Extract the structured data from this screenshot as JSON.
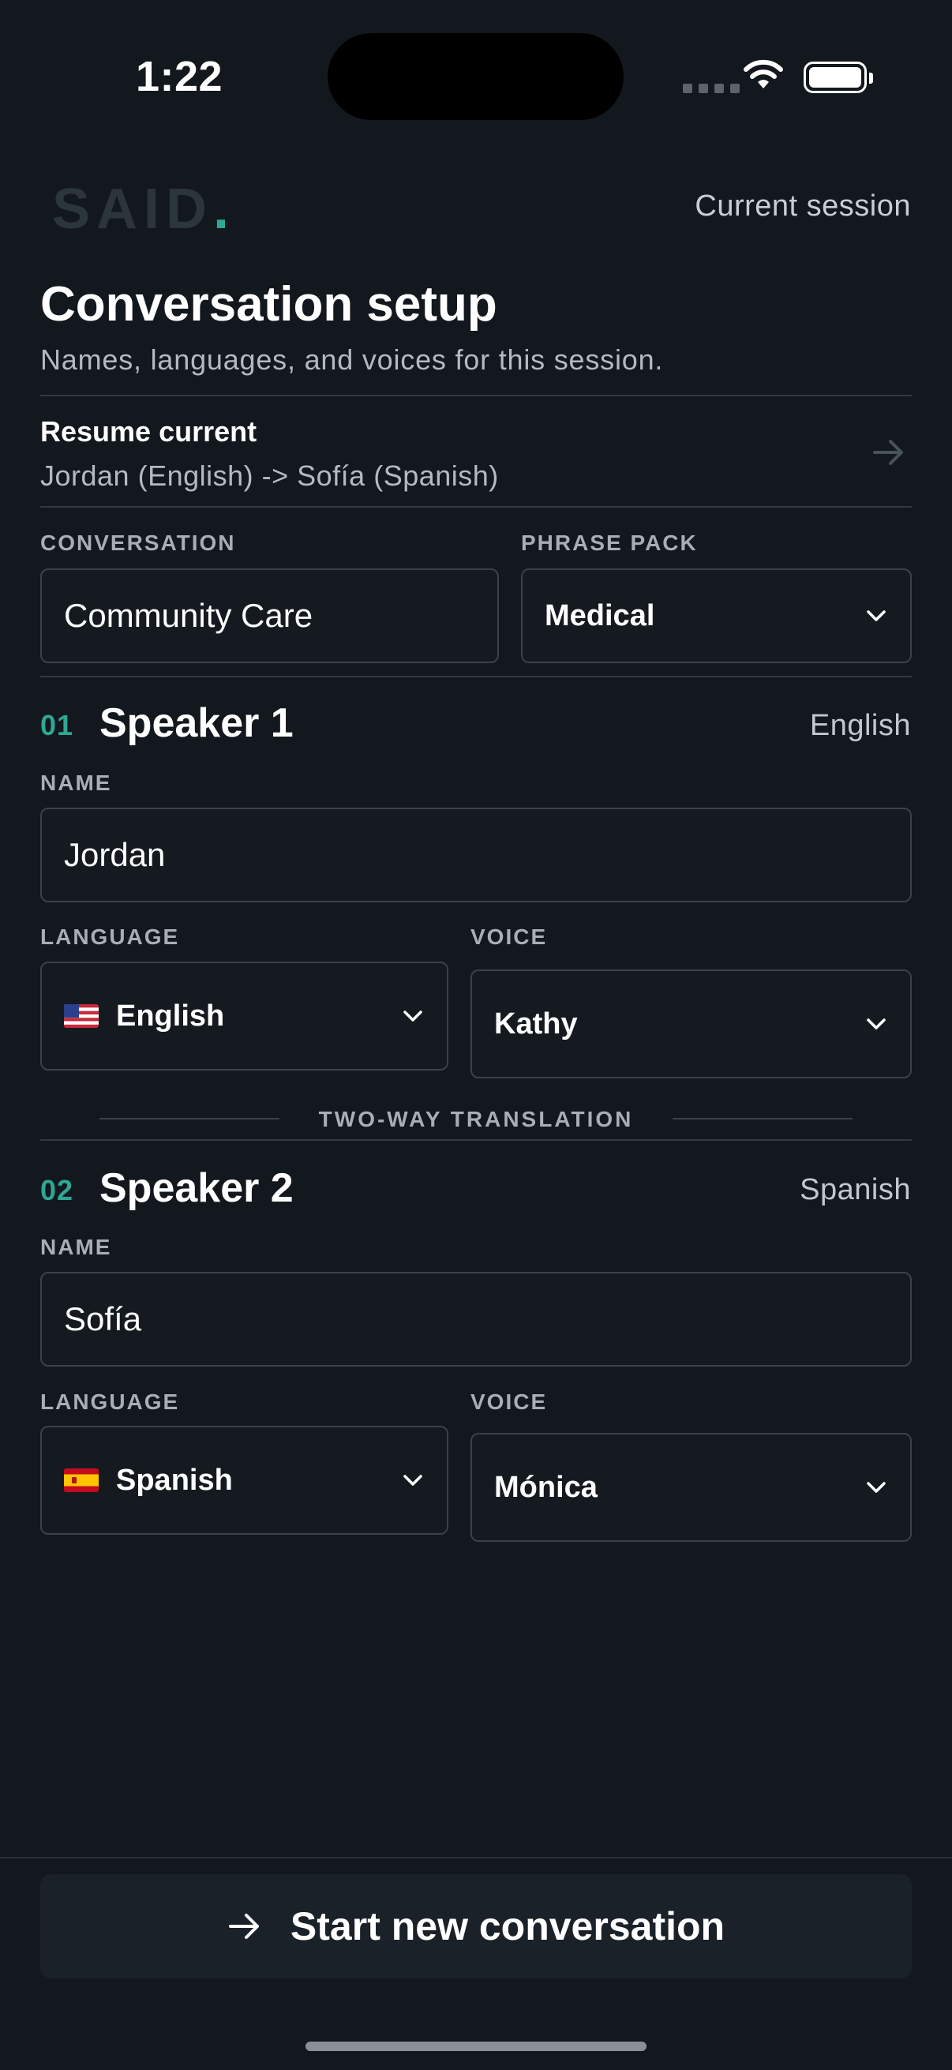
{
  "status_bar": {
    "time": "1:22"
  },
  "header": {
    "logo_text": "SAID",
    "logo_dot": ".",
    "session_link": "Current session"
  },
  "page": {
    "title": "Conversation setup",
    "subtitle": "Names, languages, and voices for this session."
  },
  "resume": {
    "title": "Resume current",
    "summary": "Jordan (English) -> Sofía (Spanish)"
  },
  "conversation": {
    "label": "CONVERSATION",
    "value": "Community Care"
  },
  "phrase_pack": {
    "label": "PHRASE PACK",
    "value": "Medical"
  },
  "speaker1": {
    "number": "01",
    "title": "Speaker 1",
    "language_summary": "English",
    "name_label": "NAME",
    "name_value": "Jordan",
    "language_label": "LANGUAGE",
    "language_value": "English",
    "language_flag": "us-flag",
    "voice_label": "VOICE",
    "voice_value": "Kathy"
  },
  "divider": {
    "label": "TWO-WAY TRANSLATION"
  },
  "speaker2": {
    "number": "02",
    "title": "Speaker 2",
    "language_summary": "Spanish",
    "name_label": "NAME",
    "name_value": "Sofía",
    "language_label": "LANGUAGE",
    "language_value": "Spanish",
    "language_flag": "es-flag",
    "voice_label": "VOICE",
    "voice_value": "Mónica"
  },
  "footer": {
    "start_button": "Start new conversation"
  },
  "colors": {
    "background": "#13181e",
    "accent": "#2fa792",
    "border": "#39424b",
    "button_bg": "#1a2129"
  }
}
